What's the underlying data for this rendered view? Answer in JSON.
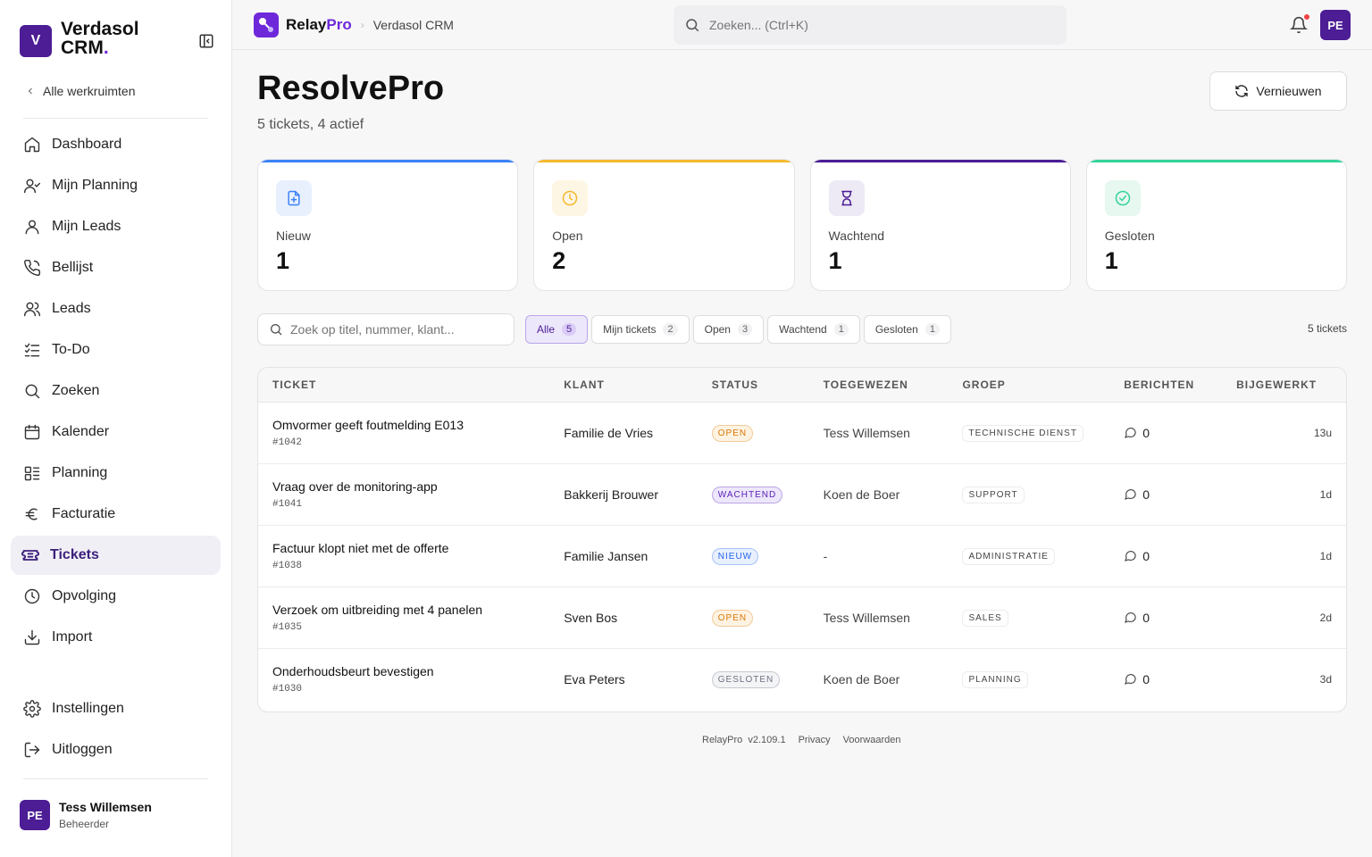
{
  "sidebar": {
    "brand_logo": "V",
    "brand_name": "Verdasol CRM",
    "brand_dot": ".",
    "back_link": "Alle werkruimten",
    "nav": [
      {
        "label": "Dashboard",
        "icon": "home-icon"
      },
      {
        "label": "Mijn Planning",
        "icon": "user-check-icon"
      },
      {
        "label": "Mijn Leads",
        "icon": "user-icon"
      },
      {
        "label": "Bellijst",
        "icon": "phone-icon"
      },
      {
        "label": "Leads",
        "icon": "users-icon"
      },
      {
        "label": "To-Do",
        "icon": "list-check-icon"
      },
      {
        "label": "Zoeken",
        "icon": "search-icon"
      },
      {
        "label": "Kalender",
        "icon": "calendar-icon"
      },
      {
        "label": "Planning",
        "icon": "layout-list-icon"
      },
      {
        "label": "Facturatie",
        "icon": "euro-icon"
      },
      {
        "label": "Tickets",
        "icon": "ticket-icon",
        "active": true
      },
      {
        "label": "Opvolging",
        "icon": "clock-icon"
      },
      {
        "label": "Import",
        "icon": "download-icon"
      }
    ],
    "bottom_nav": [
      {
        "label": "Instellingen",
        "icon": "gear-icon"
      },
      {
        "label": "Uitloggen",
        "icon": "logout-icon"
      }
    ],
    "user": {
      "initials": "PE",
      "name": "Tess Willemsen",
      "role": "Beheerder"
    }
  },
  "topbar": {
    "app_name": "Relay",
    "app_name_accent": "Pro",
    "crumb": "Verdasol CRM",
    "search_placeholder": "Zoeken... (Ctrl+K)",
    "avatar_initials": "PE"
  },
  "page": {
    "title": "ResolvePro",
    "subtitle": "5 tickets, 4 actief",
    "refresh_label": "Vernieuwen"
  },
  "stats": [
    {
      "label": "Nieuw",
      "value": "1",
      "color": "#3b82f6",
      "bg": "#e8f0fe",
      "icon": "file-plus-icon"
    },
    {
      "label": "Open",
      "value": "2",
      "color": "#f5b92e",
      "bg": "#fef6e4",
      "icon": "clock-icon"
    },
    {
      "label": "Wachtend",
      "value": "1",
      "color": "#4c1d95",
      "bg": "#ede9f5",
      "icon": "hourglass-icon"
    },
    {
      "label": "Gesloten",
      "value": "1",
      "color": "#34d399",
      "bg": "#e6f8f0",
      "icon": "check-circle-icon"
    }
  ],
  "filters": {
    "search_placeholder": "Zoek op titel, nummer, klant...",
    "chips": [
      {
        "label": "Alle",
        "count": "5",
        "active": true
      },
      {
        "label": "Mijn tickets",
        "count": "2"
      },
      {
        "label": "Open",
        "count": "3"
      },
      {
        "label": "Wachtend",
        "count": "1"
      },
      {
        "label": "Gesloten",
        "count": "1"
      }
    ],
    "count_label": "5 tickets"
  },
  "table": {
    "headers": [
      "TICKET",
      "KLANT",
      "STATUS",
      "TOEGEWEZEN",
      "GROEP",
      "BERICHTEN",
      "BIJGEWERKT"
    ],
    "rows": [
      {
        "title": "Omvormer geeft foutmelding E013",
        "number": "#1042",
        "client": "Familie de Vries",
        "status": "OPEN",
        "status_color": "#d97706",
        "status_bg": "#fef3e2",
        "assignee": "Tess Willemsen",
        "group": "TECHNISCHE DIENST",
        "messages": "0",
        "updated": "13u"
      },
      {
        "title": "Vraag over de monitoring-app",
        "number": "#1041",
        "client": "Bakkerij Brouwer",
        "status": "WACHTEND",
        "status_color": "#5b21b6",
        "status_bg": "#ede7fb",
        "assignee": "Koen de Boer",
        "group": "SUPPORT",
        "messages": "0",
        "updated": "1d"
      },
      {
        "title": "Factuur klopt niet met de offerte",
        "number": "#1038",
        "client": "Familie Jansen",
        "status": "NIEUW",
        "status_color": "#2563eb",
        "status_bg": "#e8f0fe",
        "assignee": "-",
        "group": "ADMINISTRATIE",
        "messages": "0",
        "updated": "1d"
      },
      {
        "title": "Verzoek om uitbreiding met 4 panelen",
        "number": "#1035",
        "client": "Sven Bos",
        "status": "OPEN",
        "status_color": "#d97706",
        "status_bg": "#fef3e2",
        "assignee": "Tess Willemsen",
        "group": "SALES",
        "messages": "0",
        "updated": "2d"
      },
      {
        "title": "Onderhoudsbeurt bevestigen",
        "number": "#1030",
        "client": "Eva Peters",
        "status": "GESLOTEN",
        "status_color": "#6b7280",
        "status_bg": "#f3f4f6",
        "assignee": "Koen de Boer",
        "group": "PLANNING",
        "messages": "0",
        "updated": "3d"
      }
    ]
  },
  "footer": {
    "app": "RelayPro",
    "version": "v2.109.1",
    "privacy": "Privacy",
    "terms": "Voorwaarden"
  }
}
